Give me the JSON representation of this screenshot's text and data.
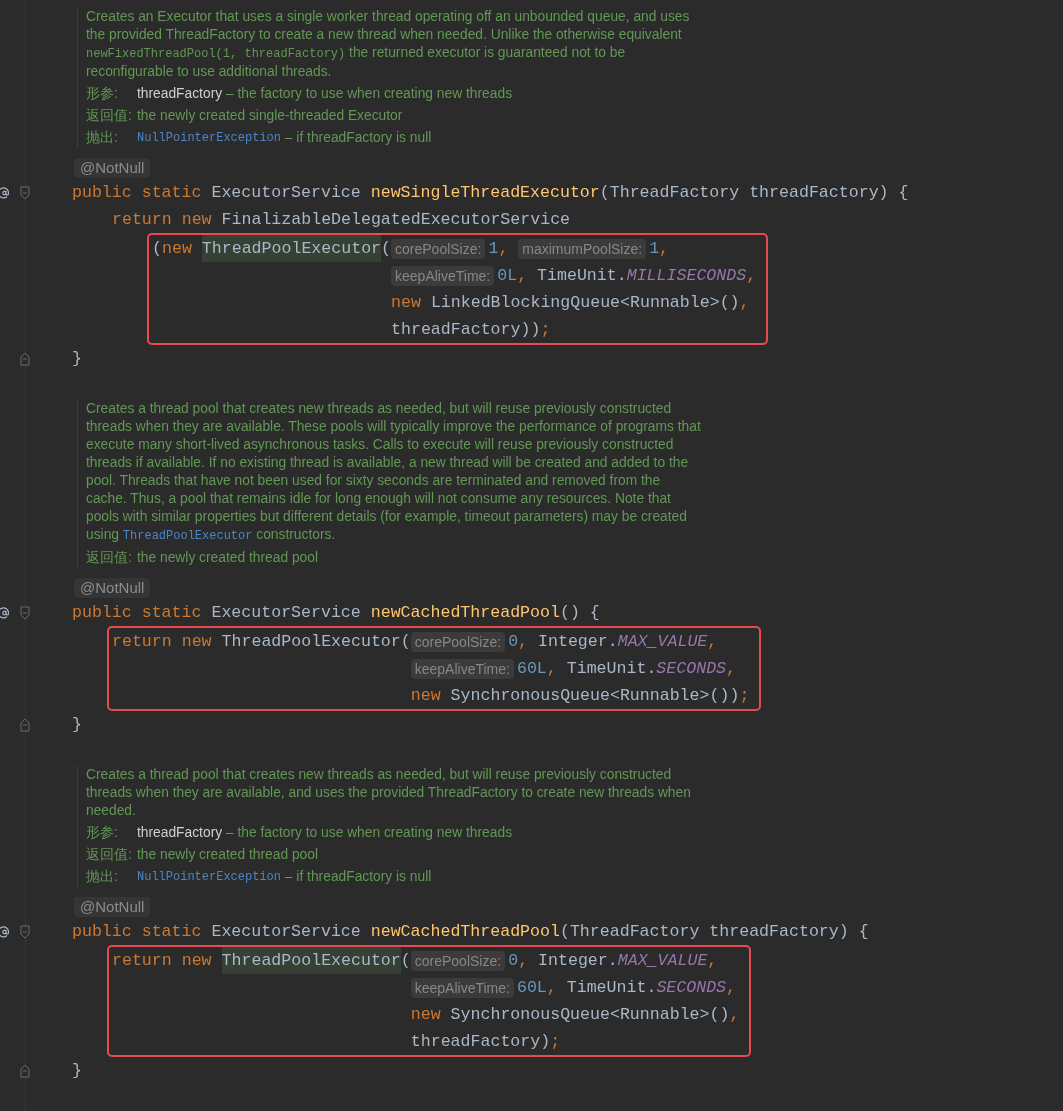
{
  "methods": [
    {
      "doc": {
        "paragraph": [
          {
            "kind": "text",
            "text": "Creates an Executor that uses a single worker thread operating off an unbounded queue, and uses the provided ThreadFactory to create a new thread when needed. Unlike the otherwise equivalent "
          },
          {
            "kind": "code",
            "text": "newFixedThreadPool(1, threadFactory)"
          },
          {
            "kind": "text",
            "text": " the returned executor is guaranteed not to be reconfigurable to use additional threads."
          }
        ],
        "tags": [
          {
            "label": "形参:",
            "name": "threadFactory",
            "kind": "param",
            "text": " – the factory to use when creating new threads"
          },
          {
            "label": "返回值:",
            "text": "the newly created single-threaded Executor"
          },
          {
            "label": "抛出:",
            "name": "NullPointerException",
            "kind": "link",
            "text": " – if threadFactory is null"
          }
        ]
      },
      "annotation": "@NotNull",
      "signature": [
        {
          "kind": "keyword",
          "text": "public static "
        },
        {
          "kind": "type",
          "text": "ExecutorService "
        },
        {
          "kind": "method",
          "text": "newSingleThreadExecutor"
        },
        {
          "kind": "plain",
          "text": "(ThreadFactory threadFactory) {"
        }
      ],
      "body": [
        {
          "tokens": [
            {
              "kind": "keyword",
              "text": "return new "
            },
            {
              "kind": "plain",
              "text": "FinalizableDelegatedExecutorService"
            }
          ],
          "children": [
            {
              "highlighted": true,
              "tokens": [
                {
                  "kind": "plain",
                  "text": "("
                },
                {
                  "kind": "keyword",
                  "text": "new "
                },
                {
                  "kind": "plain",
                  "text": "ThreadPoolExecutor",
                  "marked": true
                },
                {
                  "kind": "plain",
                  "text": "("
                }
              ],
              "args": [
                [
                  {
                    "kind": "hint",
                    "text": "corePoolSize:"
                  },
                  {
                    "kind": "number",
                    "text": "1"
                  },
                  {
                    "kind": "punct",
                    "text": ", "
                  },
                  {
                    "kind": "hint",
                    "text": "maximumPoolSize:"
                  },
                  {
                    "kind": "number",
                    "text": "1"
                  },
                  {
                    "kind": "punct",
                    "text": ","
                  }
                ],
                [
                  {
                    "kind": "hint",
                    "text": "keepAliveTime:"
                  },
                  {
                    "kind": "number",
                    "text": "0L"
                  },
                  {
                    "kind": "punct",
                    "text": ", "
                  },
                  {
                    "kind": "plain",
                    "text": "TimeUnit."
                  },
                  {
                    "kind": "constant",
                    "text": "MILLISECONDS"
                  },
                  {
                    "kind": "punct",
                    "text": ","
                  }
                ],
                [
                  {
                    "kind": "keyword",
                    "text": "new "
                  },
                  {
                    "kind": "plain",
                    "text": "LinkedBlockingQueue<Runnable>()"
                  },
                  {
                    "kind": "punct",
                    "text": ","
                  }
                ],
                [
                  {
                    "kind": "plain",
                    "text": "threadFactory))"
                  },
                  {
                    "kind": "punct",
                    "text": ";"
                  }
                ]
              ]
            }
          ]
        }
      ],
      "closing": "}"
    },
    {
      "doc": {
        "paragraph": [
          {
            "kind": "text",
            "text": "Creates a thread pool that creates new threads as needed, but will reuse previously constructed threads when they are available. These pools will typically improve the performance of programs that execute many short-lived asynchronous tasks. Calls to execute will reuse previously constructed threads if available. If no existing thread is available, a new thread will be created and added to the pool. Threads that have not been used for sixty seconds are terminated and removed from the cache. Thus, a pool that remains idle for long enough will not consume any resources. Note that pools with similar properties but different details (for example, timeout parameters) may be created using "
          },
          {
            "kind": "link",
            "text": "ThreadPoolExecutor"
          },
          {
            "kind": "text",
            "text": " constructors."
          }
        ],
        "tags": [
          {
            "label": "返回值:",
            "text": "the newly created thread pool"
          }
        ]
      },
      "annotation": "@NotNull",
      "signature": [
        {
          "kind": "keyword",
          "text": "public static "
        },
        {
          "kind": "type",
          "text": "ExecutorService "
        },
        {
          "kind": "method",
          "text": "newCachedThreadPool"
        },
        {
          "kind": "plain",
          "text": "() {"
        }
      ],
      "body": [
        {
          "highlighted": true,
          "tokens": [
            {
              "kind": "keyword",
              "text": "return new "
            },
            {
              "kind": "plain",
              "text": "ThreadPoolExecutor("
            }
          ],
          "args": [
            [
              {
                "kind": "hint",
                "text": "corePoolSize:"
              },
              {
                "kind": "number",
                "text": "0"
              },
              {
                "kind": "punct",
                "text": ", "
              },
              {
                "kind": "plain",
                "text": "Integer."
              },
              {
                "kind": "constant",
                "text": "MAX_VALUE"
              },
              {
                "kind": "punct",
                "text": ","
              }
            ],
            [
              {
                "kind": "hint",
                "text": "keepAliveTime:"
              },
              {
                "kind": "number",
                "text": "60L"
              },
              {
                "kind": "punct",
                "text": ", "
              },
              {
                "kind": "plain",
                "text": "TimeUnit."
              },
              {
                "kind": "constant",
                "text": "SECONDS"
              },
              {
                "kind": "punct",
                "text": ","
              }
            ],
            [
              {
                "kind": "keyword",
                "text": "new "
              },
              {
                "kind": "plain",
                "text": "SynchronousQueue<Runnable>())"
              },
              {
                "kind": "punct",
                "text": ";"
              }
            ]
          ]
        }
      ],
      "closing": "}"
    },
    {
      "doc": {
        "paragraph": [
          {
            "kind": "text",
            "text": "Creates a thread pool that creates new threads as needed, but will reuse previously constructed threads when they are available, and uses the provided ThreadFactory to create new threads when needed."
          }
        ],
        "tags": [
          {
            "label": "形参:",
            "name": "threadFactory",
            "kind": "param",
            "text": " – the factory to use when creating new threads"
          },
          {
            "label": "返回值:",
            "text": "the newly created thread pool"
          },
          {
            "label": "抛出:",
            "name": "NullPointerException",
            "kind": "link",
            "text": " – if threadFactory is null"
          }
        ]
      },
      "annotation": "@NotNull",
      "signature": [
        {
          "kind": "keyword",
          "text": "public static "
        },
        {
          "kind": "type",
          "text": "ExecutorService "
        },
        {
          "kind": "method",
          "text": "newCachedThreadPool"
        },
        {
          "kind": "plain",
          "text": "(ThreadFactory threadFactory) {"
        }
      ],
      "body": [
        {
          "highlighted": true,
          "tokens": [
            {
              "kind": "keyword",
              "text": "return new "
            },
            {
              "kind": "plain",
              "text": "ThreadPoolExecutor",
              "marked": true
            },
            {
              "kind": "plain",
              "text": "("
            }
          ],
          "args": [
            [
              {
                "kind": "hint",
                "text": "corePoolSize:"
              },
              {
                "kind": "number",
                "text": "0"
              },
              {
                "kind": "punct",
                "text": ", "
              },
              {
                "kind": "plain",
                "text": "Integer."
              },
              {
                "kind": "constant",
                "text": "MAX_VALUE"
              },
              {
                "kind": "punct",
                "text": ","
              }
            ],
            [
              {
                "kind": "hint",
                "text": "keepAliveTime:"
              },
              {
                "kind": "number",
                "text": "60L"
              },
              {
                "kind": "punct",
                "text": ", "
              },
              {
                "kind": "plain",
                "text": "TimeUnit."
              },
              {
                "kind": "constant",
                "text": "SECONDS"
              },
              {
                "kind": "punct",
                "text": ","
              }
            ],
            [
              {
                "kind": "keyword",
                "text": "new "
              },
              {
                "kind": "plain",
                "text": "SynchronousQueue<Runnable>()"
              },
              {
                "kind": "punct",
                "text": ","
              }
            ],
            [
              {
                "kind": "plain",
                "text": "threadFactory)"
              },
              {
                "kind": "punct",
                "text": ";"
              }
            ]
          ]
        }
      ],
      "closing": "}"
    }
  ]
}
